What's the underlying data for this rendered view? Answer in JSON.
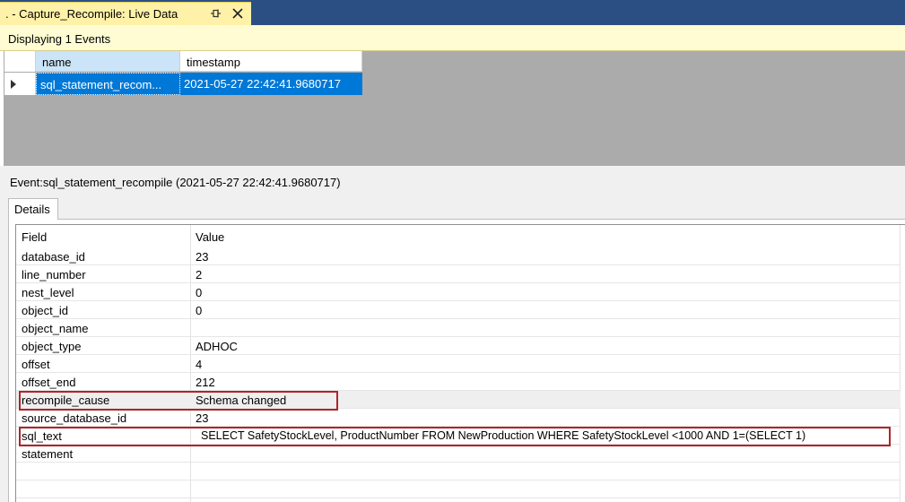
{
  "window": {
    "tab_title": ". - Capture_Recompile: Live Data",
    "pin_icon": "pin-icon",
    "close_icon": "close-icon"
  },
  "info_bar": {
    "text": "Displaying 1 Events"
  },
  "events_grid": {
    "columns": [
      "name",
      "timestamp"
    ],
    "rows": [
      {
        "name": "sql_statement_recom...",
        "timestamp": "2021-05-27 22:42:41.9680717"
      }
    ]
  },
  "event_caption": "Event:sql_statement_recompile (2021-05-27 22:42:41.9680717)",
  "details_tab": {
    "label": "Details"
  },
  "details": {
    "headers": {
      "field": "Field",
      "value": "Value"
    },
    "rows": [
      {
        "field": "database_id",
        "value": "23"
      },
      {
        "field": "line_number",
        "value": "2"
      },
      {
        "field": "nest_level",
        "value": "0"
      },
      {
        "field": "object_id",
        "value": "0"
      },
      {
        "field": "object_name",
        "value": ""
      },
      {
        "field": "object_type",
        "value": "ADHOC"
      },
      {
        "field": "offset",
        "value": "4"
      },
      {
        "field": "offset_end",
        "value": "212"
      },
      {
        "field": "recompile_cause",
        "value": "Schema changed"
      },
      {
        "field": "source_database_id",
        "value": "23"
      },
      {
        "field": "sql_text",
        "value": "SELECT SafetyStockLevel, ProductNumber FROM NewProduction  WHERE SafetyStockLevel <1000  AND 1=(SELECT 1)"
      },
      {
        "field": "statement",
        "value": ""
      }
    ]
  },
  "colors": {
    "tabstrip": "#2b4f82",
    "active_tab": "#fff2a8",
    "selection": "#0078d7",
    "highlight_border": "#b0242a"
  }
}
